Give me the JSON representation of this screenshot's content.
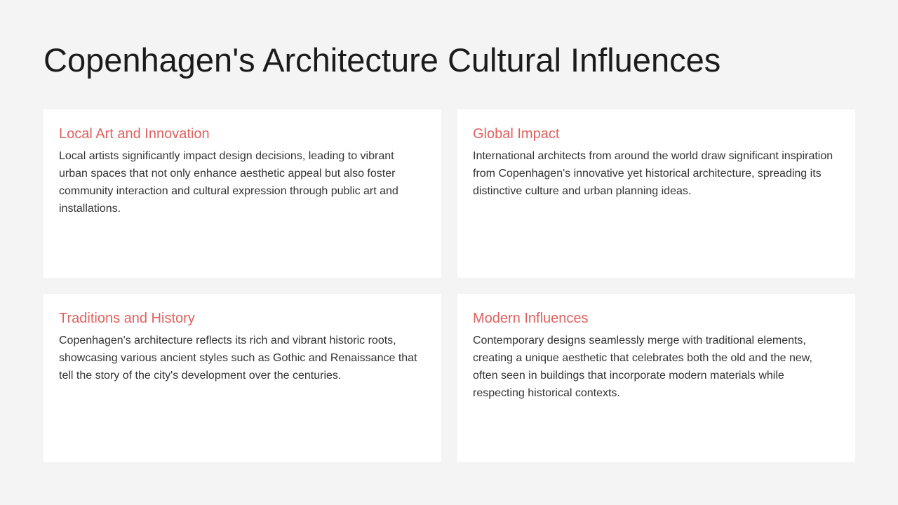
{
  "title": "Copenhagen's Architecture Cultural Influences",
  "cards": [
    {
      "heading": "Local Art and Innovation",
      "body": "Local artists significantly impact design decisions, leading to vibrant urban spaces that not only enhance aesthetic appeal but also foster community interaction and cultural expression through public art and installations."
    },
    {
      "heading": "Global Impact",
      "body": "International architects from around the world draw significant inspiration from Copenhagen's innovative yet historical architecture, spreading its distinctive culture and urban planning ideas."
    },
    {
      "heading": "Traditions and History",
      "body": "Copenhagen's architecture reflects its rich and vibrant historic roots, showcasing various ancient styles such as Gothic and Renaissance that tell the story of the city's development over the centuries."
    },
    {
      "heading": "Modern Influences",
      "body": "Contemporary designs seamlessly merge with traditional elements, creating a unique aesthetic that celebrates both the old and the new, often seen in buildings that incorporate modern materials while respecting historical contexts."
    }
  ],
  "colors": {
    "background": "#f4f4f4",
    "card_background": "#ffffff",
    "heading_accent": "#e0625f",
    "title_text": "#1b1b1b",
    "body_text": "#333333"
  }
}
